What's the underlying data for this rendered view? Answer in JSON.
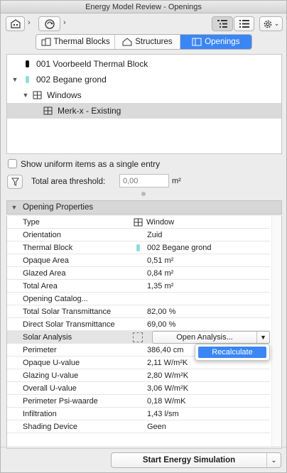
{
  "window": {
    "title": "Energy Model Review - Openings"
  },
  "toolbar": {
    "icons": [
      "building-export-icon",
      "chevron-right-icon",
      "refresh-icon",
      "chevron-right-icon",
      "tree-view-icon",
      "list-view-icon",
      "gear-icon",
      "chevron-down-icon"
    ]
  },
  "tabs": [
    {
      "label": "Thermal Blocks",
      "icon": "thermal-blocks-icon",
      "active": false
    },
    {
      "label": "Structures",
      "icon": "house-icon",
      "active": false
    },
    {
      "label": "Openings",
      "icon": "openings-icon",
      "active": true
    }
  ],
  "tree": {
    "items": [
      {
        "label": "001 Voorbeeld Thermal Block",
        "color": "#111111"
      },
      {
        "label": "002 Begane grond",
        "color": "#8fdcdc",
        "expanded": true
      },
      {
        "label": "Windows",
        "expanded": true
      },
      {
        "label": "Merk-x - Existing",
        "selected": true
      }
    ]
  },
  "options": {
    "uniform_label": "Show uniform items as a single entry",
    "threshold_label": "Total area threshold:",
    "threshold_placeholder": "0,00",
    "threshold_unit": "m²"
  },
  "properties": {
    "header": "Opening Properties",
    "rows": [
      {
        "label": "Type",
        "value": "Window"
      },
      {
        "label": "Orientation",
        "value": "Zuid"
      },
      {
        "label": "Thermal Block",
        "value": "002 Begane grond"
      },
      {
        "label": "Opaque Area",
        "value": "0,51 m²"
      },
      {
        "label": "Glazed Area",
        "value": "0,84 m²"
      },
      {
        "label": "Total Area",
        "value": "1,35 m²"
      },
      {
        "label": "Opening Catalog...",
        "value": ""
      },
      {
        "label": "Total Solar Transmittance",
        "value": "82,00 %"
      },
      {
        "label": "Direct Solar Transmittance",
        "value": "69,00 %"
      },
      {
        "label": "Solar Analysis",
        "value": "Open Analysis..."
      },
      {
        "label": "Perimeter",
        "value": "386,40 cm"
      },
      {
        "label": "Opaque U-value",
        "value": "2,11 W/m²K"
      },
      {
        "label": "Glazing U-value",
        "value": "2,80 W/m²K"
      },
      {
        "label": "Overall U-value",
        "value": "3,06 W/m²K"
      },
      {
        "label": "Perimeter Psi-waarde",
        "value": "0,18 W/mK"
      },
      {
        "label": "Infiltration",
        "value": "1,43 l/sm"
      },
      {
        "label": "Shading Device",
        "value": "Geen"
      }
    ],
    "menu_item": "Recalculate"
  },
  "footer": {
    "simulate_label": "Start Energy Simulation"
  },
  "colors": {
    "accent": "#3a86f4",
    "thermal_block_2": "#8fdcdc"
  }
}
